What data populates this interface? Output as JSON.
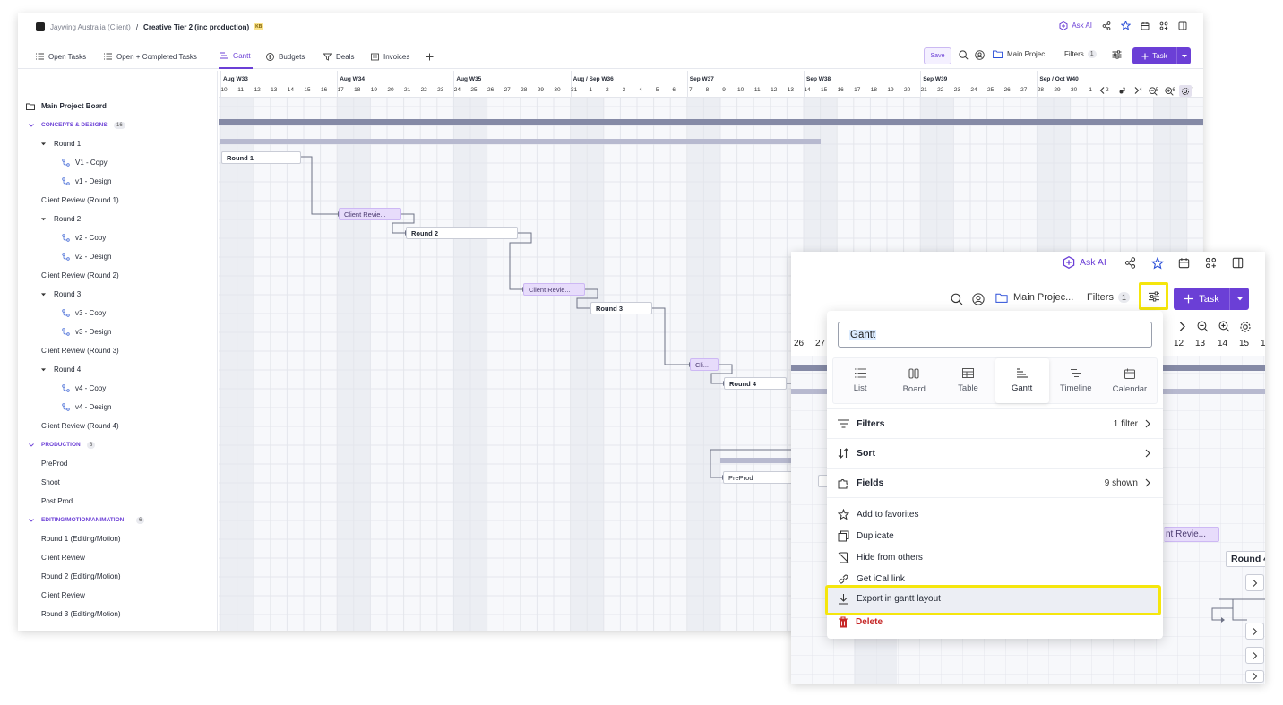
{
  "breadcrumb": {
    "client": "Jaywing Australia (Client)",
    "separator": "/",
    "project": "Creative Tier 2 (inc production)",
    "badge": "KB"
  },
  "header": {
    "ask_ai": "Ask AI"
  },
  "tabs": [
    {
      "label": "Open Tasks",
      "icon": "list-icon"
    },
    {
      "label": "Open + Completed Tasks",
      "icon": "list-icon"
    },
    {
      "label": "Gantt",
      "icon": "gantt-icon",
      "active": true
    },
    {
      "label": "Budgets.",
      "icon": "dollar-icon"
    },
    {
      "label": "Deals",
      "icon": "filter-icon"
    },
    {
      "label": "Invoices",
      "icon": "invoice-icon"
    }
  ],
  "toolbar": {
    "save": "Save",
    "project": "Main Projec...",
    "filters": "Filters",
    "filters_count": "1",
    "task": "Task"
  },
  "sidebar": {
    "board": "Main Project Board",
    "groups": {
      "concepts": {
        "label": "CONCEPTS & DESIGNS",
        "count": "16"
      },
      "production": {
        "label": "PRODUCTION",
        "count": "3"
      },
      "editing": {
        "label": "EDITING/MOTION/ANIMATION",
        "count": "6"
      }
    },
    "items": {
      "round1": "Round 1",
      "v1copy": "V1 - Copy",
      "v1design": "v1 - Design",
      "cr1": "Client Review (Round 1)",
      "round2": "Round 2",
      "v2copy": "v2 - Copy",
      "v2design": "v2 - Design",
      "cr2": "Client Review (Round 2)",
      "round3": "Round 3",
      "v3copy": "v3 - Copy",
      "v3design": "v3 - Design",
      "cr3": "Client Review (Round 3)",
      "round4": "Round 4",
      "v4copy": "v4 - Copy",
      "v4design": "v4 - Design",
      "cr4": "Client Review (Round 4)",
      "preprod": "PreProd",
      "shoot": "Shoot",
      "postprod": "Post Prod",
      "e1": "Round 1 (Editing/Motion)",
      "e1cr": "Client Review",
      "e2": "Round 2 (Editing/Motion)",
      "e2cr": "Client Review",
      "e3": "Round 3 (Editing/Motion)"
    }
  },
  "timeline": {
    "weeks": [
      "Aug W33",
      "Aug W34",
      "Aug W35",
      "Aug / Sep W36",
      "Sep W37",
      "Sep W38",
      "Sep W39",
      "Sep / Oct W40"
    ],
    "days": [
      "10",
      "11",
      "12",
      "13",
      "14",
      "15",
      "16",
      "17",
      "18",
      "19",
      "20",
      "21",
      "22",
      "23",
      "24",
      "25",
      "26",
      "27",
      "28",
      "29",
      "30",
      "31",
      "1",
      "2",
      "3",
      "4",
      "5",
      "6",
      "7",
      "8",
      "9",
      "10",
      "11",
      "12",
      "13",
      "14",
      "15",
      "16",
      "17",
      "18",
      "19",
      "20",
      "21",
      "22",
      "23",
      "24",
      "25",
      "26",
      "27",
      "28",
      "29",
      "30",
      "1",
      "2",
      "3",
      "4",
      "5",
      "6",
      "7"
    ]
  },
  "bars": {
    "round1": "Round 1",
    "cr1": "Client Revie...",
    "round2": "Round 2",
    "cr2": "Client Revie...",
    "round3": "Round 3",
    "cr3": "Cli...",
    "round4": "Round 4",
    "preprod": "PreProd"
  },
  "overlay": {
    "ask_ai": "Ask AI",
    "project": "Main Projec...",
    "filters": "Filters",
    "filters_count": "1",
    "task": "Task",
    "days": [
      "26",
      "27",
      "12",
      "13",
      "14",
      "15",
      "16"
    ],
    "bars": {
      "cr": "nt Revie...",
      "round4": "Round 4"
    }
  },
  "menu": {
    "view_name": "Gantt",
    "views": [
      {
        "label": "List",
        "icon": "list-icon"
      },
      {
        "label": "Board",
        "icon": "board-icon"
      },
      {
        "label": "Table",
        "icon": "table-icon"
      },
      {
        "label": "Gantt",
        "icon": "gantt-icon",
        "active": true
      },
      {
        "label": "Timeline",
        "icon": "timeline-icon"
      },
      {
        "label": "Calendar",
        "icon": "calendar-icon"
      }
    ],
    "filters": {
      "label": "Filters",
      "value": "1 filter"
    },
    "sort": {
      "label": "Sort"
    },
    "fields": {
      "label": "Fields",
      "value": "9 shown"
    },
    "items": {
      "favorites": "Add to favorites",
      "duplicate": "Duplicate",
      "hide": "Hide from others",
      "ical": "Get iCal link",
      "export": "Export in gantt layout",
      "delete": "Delete"
    }
  },
  "colors": {
    "accent": "#6b3fd6",
    "highlight": "#f5e60c",
    "review_bar": "#e7dcfb",
    "danger": "#c62828"
  }
}
